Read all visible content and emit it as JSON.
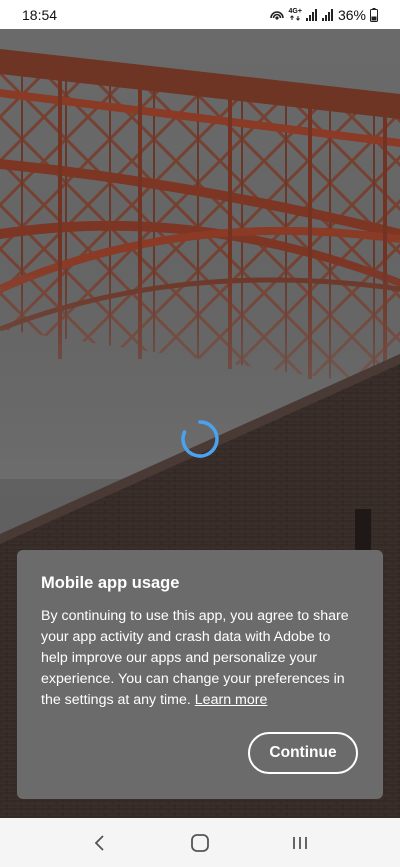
{
  "status_bar": {
    "time": "18:54",
    "network": "4G+",
    "battery": "36%",
    "icons": [
      "hotspot-icon",
      "network-4g-icon",
      "signal-icon",
      "signal-icon",
      "battery-icon"
    ]
  },
  "dialog": {
    "title": "Mobile app usage",
    "body": "By continuing to use this app, you agree to share your app activity and crash data with Adobe to help improve our apps and personalize your experience. You can change your preferences in the settings at any time.",
    "learn_more": "Learn more",
    "continue_label": "Continue"
  },
  "nav_bar": {
    "icons": [
      "back-icon",
      "home-icon",
      "recents-icon"
    ]
  },
  "colors": {
    "spinner": "#4aa3f0",
    "bridge": "#8a3a25",
    "dialog_bg": "#6b6b6b"
  }
}
